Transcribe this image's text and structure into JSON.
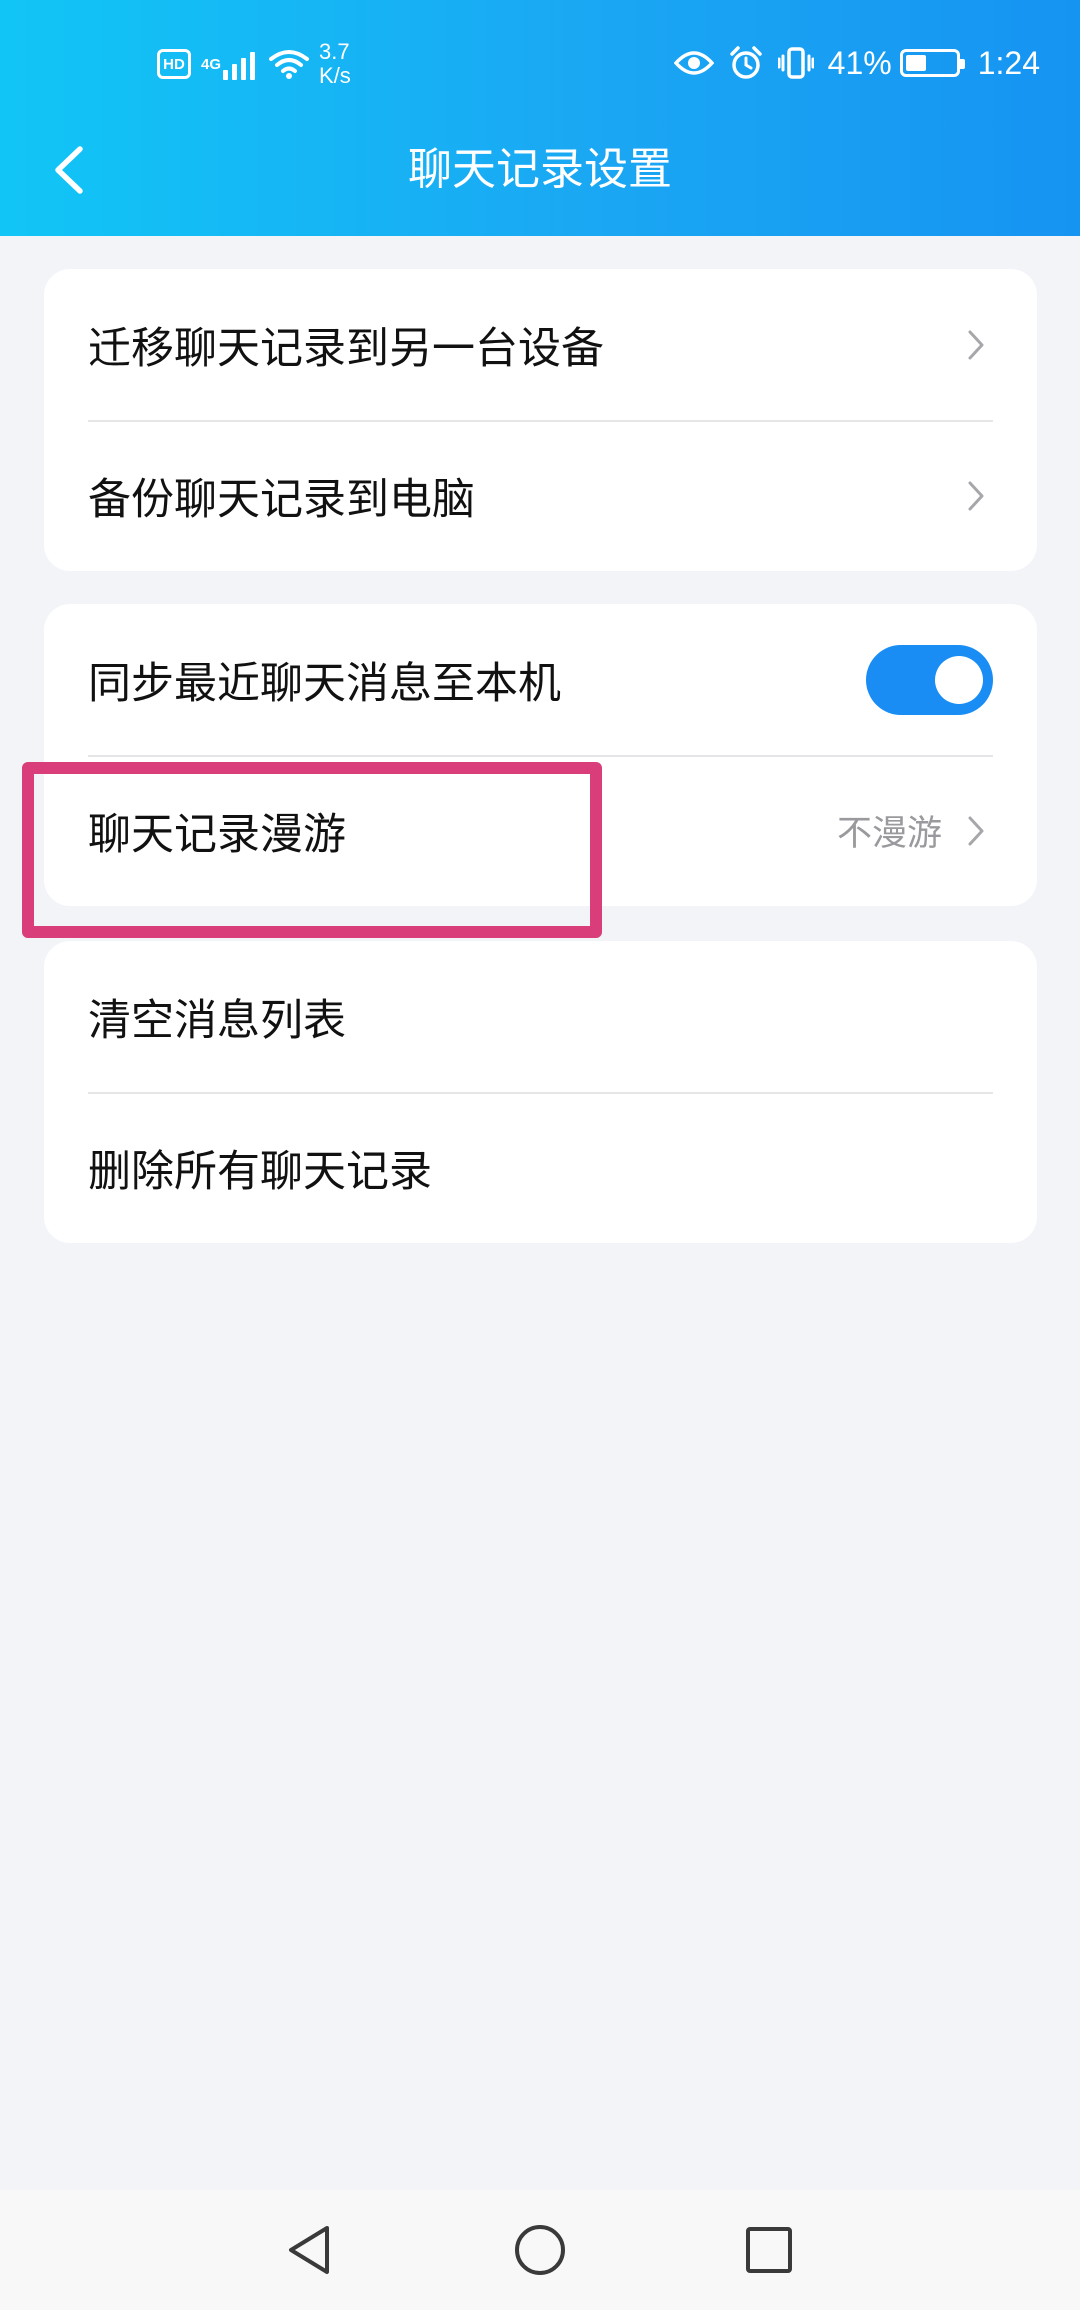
{
  "status_bar": {
    "hd_badge": "HD",
    "network_type": "4G",
    "net_speed_value": "3.7",
    "net_speed_unit": "K/s",
    "battery_percent": "41%",
    "battery_level": 0.41,
    "time": "1:24"
  },
  "header": {
    "title": "聊天记录设置",
    "background_colors": [
      "#11c6f6",
      "#1694f2"
    ]
  },
  "groups": [
    {
      "items": [
        {
          "label": "迁移聊天记录到另一台设备",
          "chevron": true
        },
        {
          "label": "备份聊天记录到电脑",
          "chevron": true
        }
      ]
    },
    {
      "items": [
        {
          "label": "同步最近聊天消息至本机",
          "toggle_on": true
        },
        {
          "label": "聊天记录漫游",
          "value": "不漫游",
          "chevron": true
        }
      ]
    },
    {
      "items": [
        {
          "label": "清空消息列表"
        },
        {
          "label": "删除所有聊天记录"
        }
      ]
    }
  ],
  "colors": {
    "toggle_on": "#1a8df4",
    "highlight_box": "#d93d7a",
    "page_background": "#f3f4f8"
  },
  "icons": {
    "back": "chevron-left-icon",
    "row_arrow": "chevron-right-icon",
    "nav": [
      "back-triangle-icon",
      "home-circle-icon",
      "recents-square-icon"
    ]
  }
}
